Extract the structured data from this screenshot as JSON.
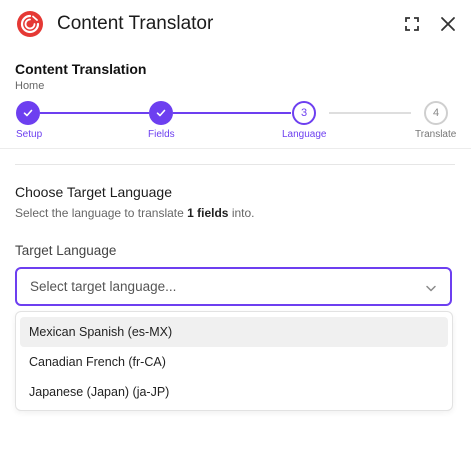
{
  "header": {
    "title": "Content Translator",
    "icons": {
      "logo": "sitecore-logo-icon",
      "expand": "expand-icon",
      "close": "close-icon"
    }
  },
  "section": {
    "title": "Content Translation",
    "breadcrumb": "Home"
  },
  "stepper": {
    "steps": [
      {
        "label": "Setup",
        "number": "1",
        "state": "completed"
      },
      {
        "label": "Fields",
        "number": "2",
        "state": "completed"
      },
      {
        "label": "Language",
        "number": "3",
        "state": "current"
      },
      {
        "label": "Translate",
        "number": "4",
        "state": "upcoming"
      }
    ]
  },
  "choose": {
    "title": "Choose Target Language",
    "desc_prefix": "Select the language to translate ",
    "desc_bold": "1 fields",
    "desc_suffix": " into."
  },
  "target": {
    "label": "Target Language",
    "placeholder": "Select target language...",
    "options": [
      "Mexican Spanish (es-MX)",
      "Canadian French (fr-CA)",
      "Japanese (Japan) (ja-JP)"
    ]
  },
  "colors": {
    "accent": "#6d3ff0",
    "logo_red": "#e53935",
    "upcoming": "#bdbdbd"
  }
}
